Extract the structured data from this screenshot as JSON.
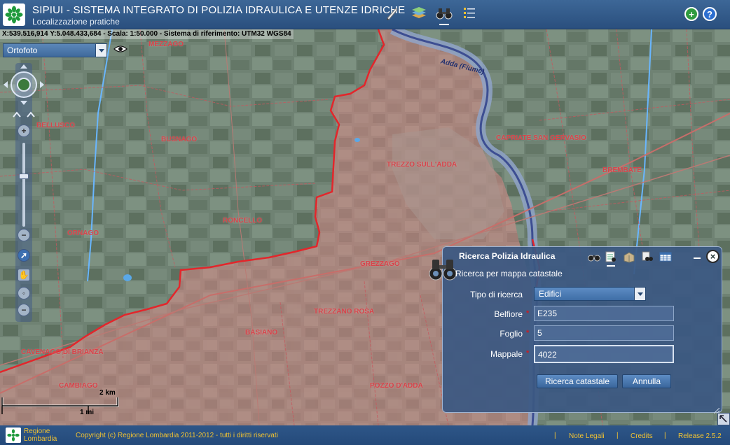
{
  "header": {
    "title": "SIPIUI - SISTEMA INTEGRATO DI POLIZIA IDRAULICA E UTENZE IDRICHE",
    "subtitle": "Localizzazione pratiche"
  },
  "map": {
    "coordinates": "X:539.516,914  Y:5.048.433,684  - Scala: 1:50.000  - Sistema di riferimento: UTM32 WGS84",
    "layer_select_value": "Ortofoto",
    "river_label": "Adda (Fiume)",
    "scale_km": "2 km",
    "scale_mi": "1 mi",
    "places": [
      {
        "name": "MEZZAGO"
      },
      {
        "name": "BELLUSCO"
      },
      {
        "name": "BUSNAGO"
      },
      {
        "name": "TREZZO SULL'ADDA"
      },
      {
        "name": "RONCELLO"
      },
      {
        "name": "ORNAGO"
      },
      {
        "name": "GREZZAGO"
      },
      {
        "name": "CAPRIATE SAN GERVASIO"
      },
      {
        "name": "BREMBATE"
      },
      {
        "name": "TREZZANO ROSA"
      },
      {
        "name": "BASIANO"
      },
      {
        "name": "CAMBIAGO"
      },
      {
        "name": "POZZO D'ADDA"
      },
      {
        "name": "CAVENAGO DI BRIANZA"
      }
    ]
  },
  "panel": {
    "title": "Ricerca Polizia Idraulica",
    "subtitle": "Ricerca per mappa catastale",
    "fields": {
      "tipo_label": "Tipo di ricerca",
      "tipo_value": "Edifici",
      "belfiore_label": "Belfiore",
      "belfiore_value": "E235",
      "foglio_label": "Foglio",
      "foglio_value": "5",
      "mappale_label": "Mappale",
      "mappale_value": "4022"
    },
    "buttons": {
      "search": "Ricerca catastale",
      "cancel": "Annulla"
    }
  },
  "footer": {
    "logo_text_line1": "Regione",
    "logo_text_line2": "Lombardia",
    "copyright": "Copyright (c) Regione Lombardia 2011-2012 - tutti i diritti riservati",
    "separators": [
      "|",
      "|",
      "|"
    ],
    "links": [
      "Note Legali",
      "Credits",
      "Release 2.5.2"
    ]
  },
  "colors": {
    "header_blue": "#2f5a8c",
    "panel_blue": "#3b5882",
    "footer_text": "#f1c232",
    "boundary_red": "#e3262b",
    "required_red": "#c0202a"
  }
}
